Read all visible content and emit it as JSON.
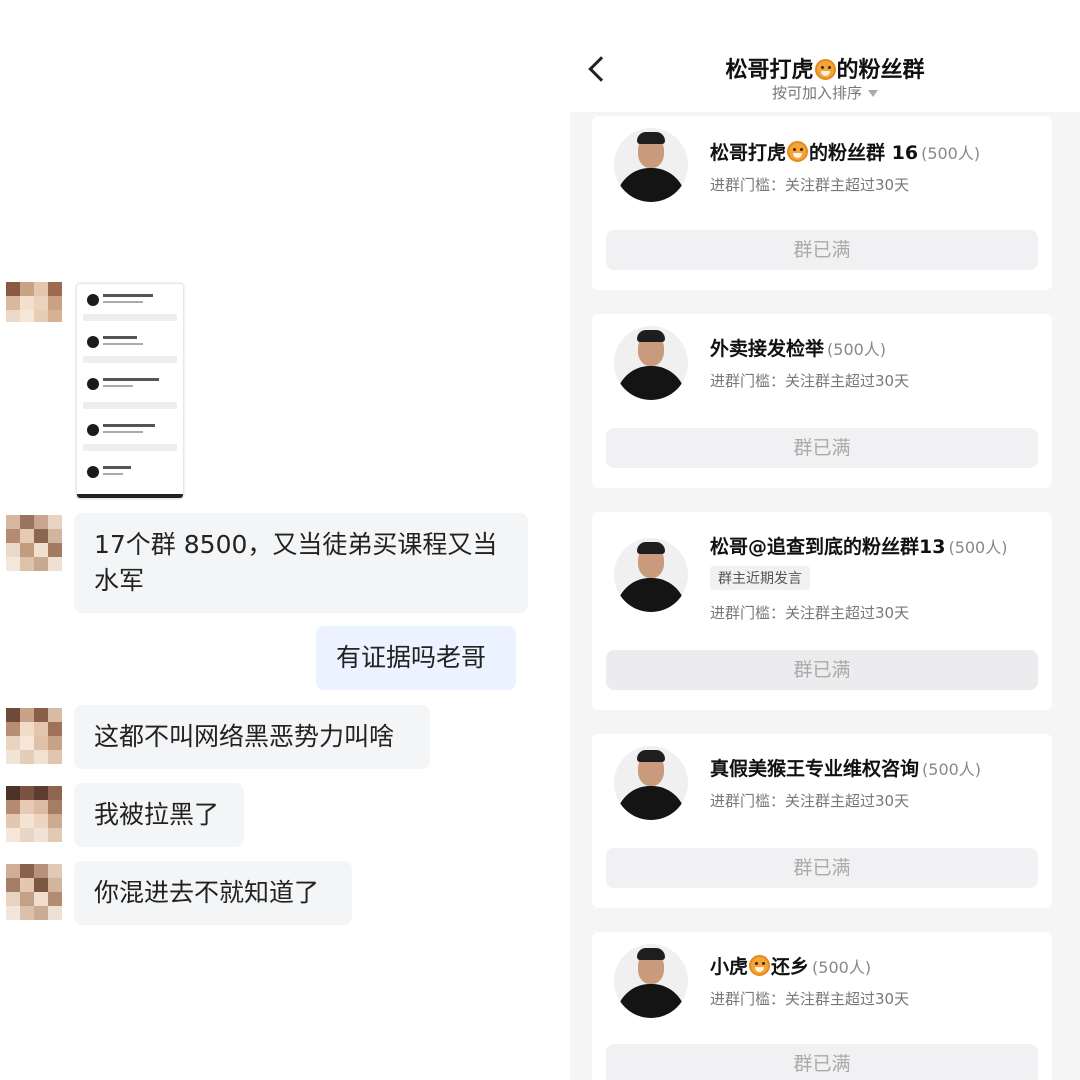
{
  "chat": {
    "messages": [
      {
        "text": "17个群 8500，又当徒弟买课程又当水军"
      },
      {
        "text": "有证据吗老哥"
      },
      {
        "text": "这都不叫网络黑恶势力叫啥"
      },
      {
        "text": "我被拉黑了"
      },
      {
        "text": "你混进去不就知道了"
      }
    ]
  },
  "phone": {
    "title_prefix": "松哥打虎",
    "title_suffix": "的粉丝群",
    "title_emoji": "tiger-icon",
    "sort_label": "按可加入排序",
    "full_label": "群已满",
    "groups": [
      {
        "name_a": "松哥打虎",
        "name_b": "的粉丝群 16",
        "count": "(500人)",
        "rule": "进群门槛：关注群主超过30天"
      },
      {
        "name": "外卖接发检举",
        "count": "(500人)",
        "rule": "进群门槛：关注群主超过30天"
      },
      {
        "name": "松哥@追查到底的粉丝群13",
        "count": "(500人)",
        "tag": "群主近期发言",
        "rule": "进群门槛：关注群主超过30天"
      },
      {
        "name": "真假美猴王专业维权咨询",
        "count": "(500人)",
        "rule": "进群门槛：关注群主超过30天"
      },
      {
        "name_a": "小虎",
        "name_b": "还乡",
        "count": "(500人)",
        "rule": "进群门槛：关注群主超过30天"
      }
    ]
  }
}
